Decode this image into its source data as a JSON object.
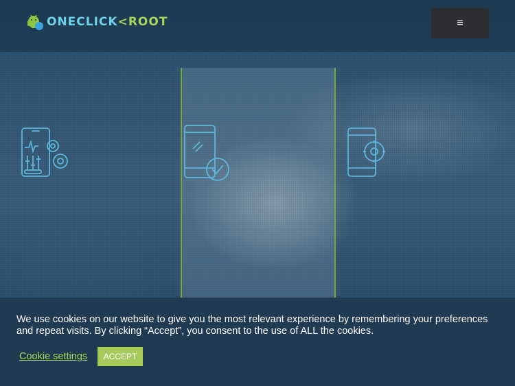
{
  "header": {
    "logo_text_main": "ONECLICK",
    "logo_text_accent": "ROOT",
    "menu_icon": "≡"
  },
  "icons": {
    "feature_1": "phone-tuning-gear-icon",
    "feature_2": "phone-check-icon",
    "feature_3": "phone-gear-icon"
  },
  "cookie": {
    "message": "We use cookies on our website to give you the most relevant experience by remembering your preferences and repeat visits. By clicking “Accept”, you consent to the use of ALL the cookies.",
    "settings_label": "Cookie settings",
    "accept_label": "ACCEPT"
  },
  "colors": {
    "accent_green": "#a5cb5a",
    "logo_cyan": "#6fd3e8",
    "icon_stroke": "#5eb6dc",
    "header_bg": "#1d3a52",
    "cookie_bg": "#1f3a51"
  }
}
